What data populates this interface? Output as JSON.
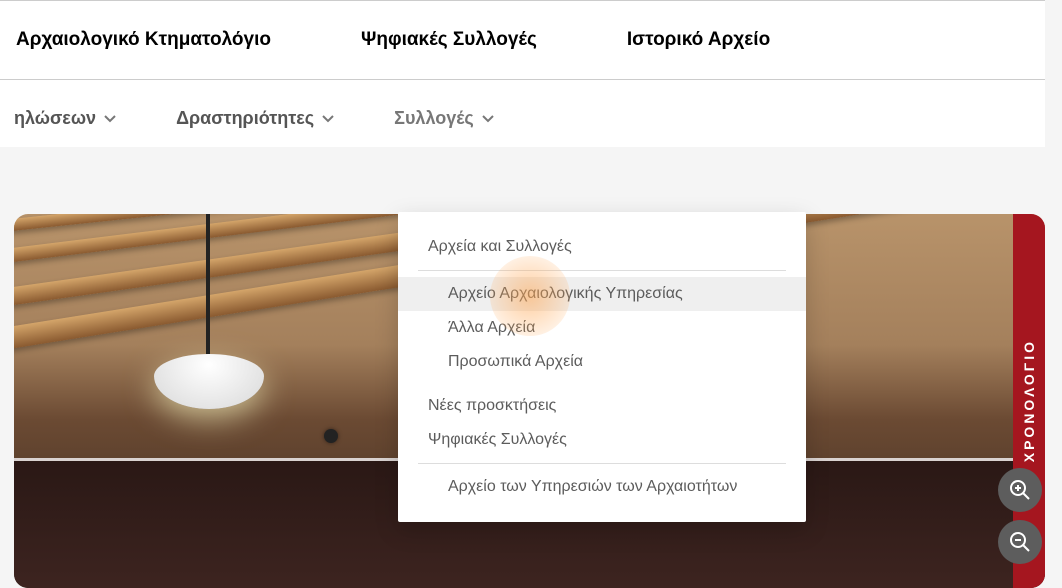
{
  "top_nav": {
    "items": [
      {
        "label": "Αρχαιολογικό Κτηματολόγιο"
      },
      {
        "label": "Ψηφιακές Συλλογές"
      },
      {
        "label": "Ιστορικό Αρχείο"
      }
    ]
  },
  "sub_nav": {
    "items": [
      {
        "label": "ηλώσεων"
      },
      {
        "label": "Δραστηριότητες"
      },
      {
        "label": "Συλλογές"
      }
    ]
  },
  "dropdown": {
    "group1_header": "Αρχεία και Συλλογές",
    "group1_items": [
      "Αρχείο Αρχαιολογικής Υπηρεσίας",
      "Άλλα Αρχεία",
      "Προσωπικά Αρχεία"
    ],
    "item2": "Νέες προσκτήσεις",
    "group3_header": "Ψηφιακές Συλλογές",
    "group3_items": [
      "Αρχείο των Υπηρεσιών των Αρχαιοτήτων"
    ]
  },
  "hero": {
    "side_label": "ΧΡΟΝΟΛΟΓΙΟ"
  },
  "colors": {
    "accent_red": "#a5161f"
  }
}
